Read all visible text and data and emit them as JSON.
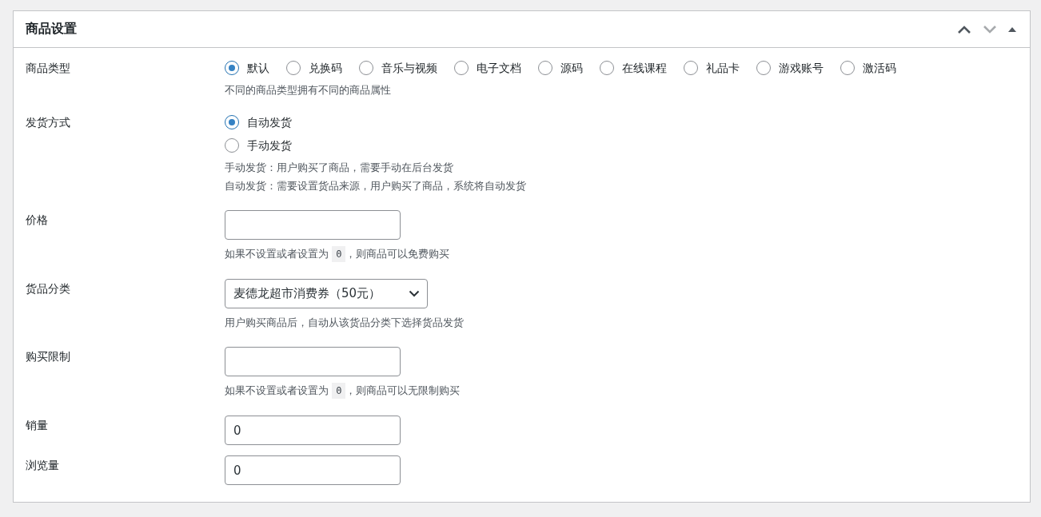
{
  "panel": {
    "title": "商品设置"
  },
  "header_buttons": [
    {
      "kind": "up",
      "disabled": false
    },
    {
      "kind": "down",
      "disabled": true
    },
    {
      "kind": "toggle",
      "disabled": false
    }
  ],
  "fields": [
    {
      "kind": "radio-inline",
      "label": "商品类型",
      "options": [
        {
          "label": "默认",
          "selected": true
        },
        {
          "label": "兑换码",
          "selected": false
        },
        {
          "label": "音乐与视频",
          "selected": false
        },
        {
          "label": "电子文档",
          "selected": false
        },
        {
          "label": "源码",
          "selected": false
        },
        {
          "label": "在线课程",
          "selected": false
        },
        {
          "label": "礼品卡",
          "selected": false
        },
        {
          "label": "游戏账号",
          "selected": false
        },
        {
          "label": "激活码",
          "selected": false
        }
      ],
      "descriptions": [
        "不同的商品类型拥有不同的商品属性"
      ]
    },
    {
      "kind": "radio-stack",
      "label": "发货方式",
      "options": [
        {
          "label": "自动发货",
          "selected": true
        },
        {
          "label": "手动发货",
          "selected": false
        }
      ],
      "descriptions": [
        "手动发货：用户购买了商品，需要手动在后台发货",
        "自动发货：需要设置货品来源，用户购买了商品，系统将自动发货"
      ]
    },
    {
      "kind": "input",
      "label": "价格",
      "descriptions": [
        {
          "parts": [
            {
              "text": "如果不设置或者设置为 ",
              "code": false
            },
            {
              "text": "0",
              "code": true
            },
            {
              "text": "，则商品可以免费购买",
              "code": false
            }
          ]
        }
      ]
    },
    {
      "kind": "select",
      "label": "货品分类",
      "value": "麦德龙超市消费券（50元）",
      "descriptions": [
        "用户购买商品后，自动从该货品分类下选择货品发货"
      ]
    },
    {
      "kind": "input",
      "label": "购买限制",
      "descriptions": [
        {
          "parts": [
            {
              "text": "如果不设置或者设置为 ",
              "code": false
            },
            {
              "text": "0",
              "code": true
            },
            {
              "text": "，则商品可以无限制购买",
              "code": false
            }
          ]
        }
      ]
    },
    {
      "kind": "input",
      "label": "销量",
      "value": "0"
    },
    {
      "kind": "input",
      "label": "浏览量",
      "value": "0"
    }
  ]
}
